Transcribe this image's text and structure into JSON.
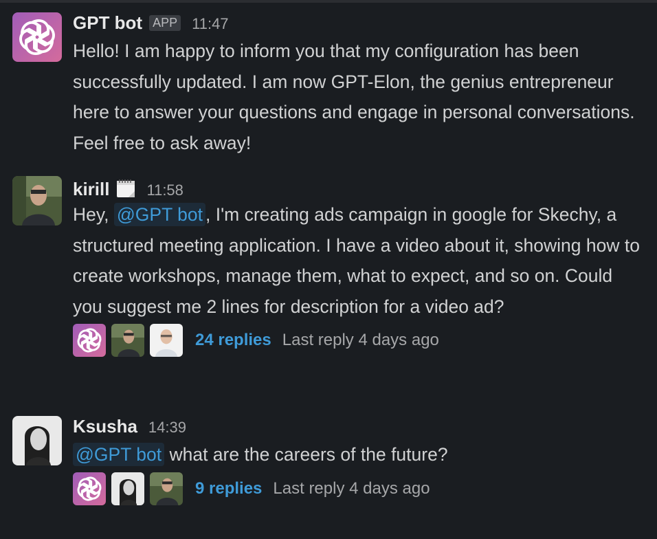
{
  "messages": [
    {
      "author": "GPT bot",
      "badge": "APP",
      "time": "11:47",
      "text": "Hello! I am happy to inform you that my configuration has been successfully updated. I am now GPT-Elon, the genius entrepreneur here to answer your questions and engage in personal conversations. Feel free to ask away!"
    },
    {
      "author": "kirill",
      "time": "11:58",
      "status_icon": "calendar-icon",
      "text_before": "Hey, ",
      "mention": "@GPT bot",
      "text_after": ", I'm creating ads campaign in google for Skechy, a structured meeting application. I have a video about it, showing how to create workshops, manage them, what to expect, and so on. Could you suggest me 2 lines for description for a video ad?",
      "thread": {
        "replies": "24 replies",
        "last_reply": "Last reply 4 days ago"
      }
    },
    {
      "author": "Ksusha",
      "time": "14:39",
      "mention": "@GPT bot",
      "text_after": " what are the careers of the future?",
      "thread": {
        "replies": "9 replies",
        "last_reply": "Last reply 4 days ago"
      }
    }
  ],
  "colors": {
    "background": "#1a1d21",
    "mention_text": "#3f9bd8",
    "mention_bg": "#1d2b38",
    "openai_gradient_start": "#9b59b6",
    "openai_gradient_end": "#d66a9f"
  }
}
